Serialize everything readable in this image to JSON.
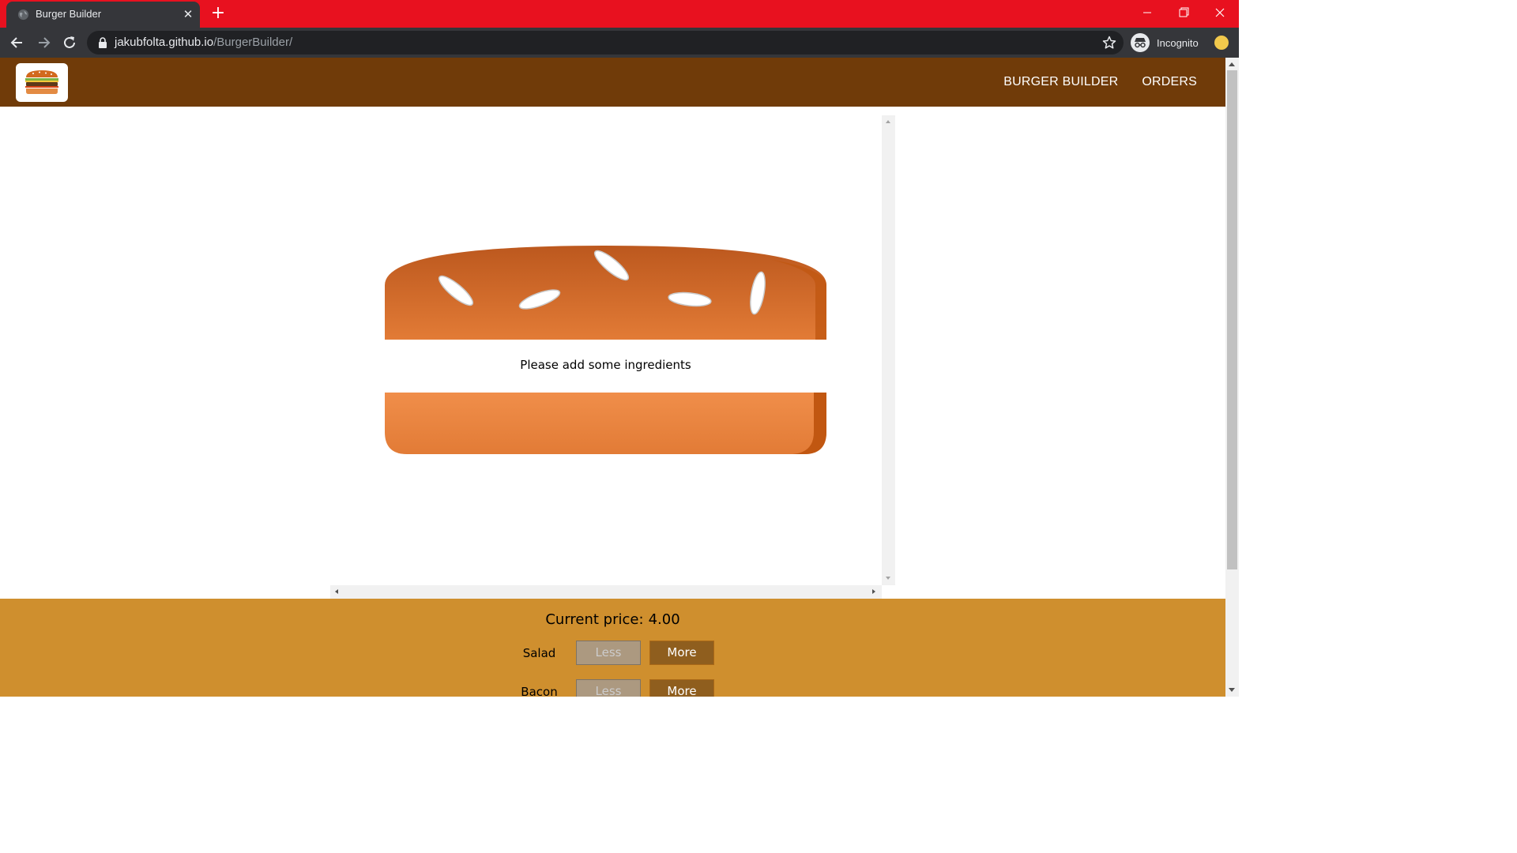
{
  "browser": {
    "tab_title": "Burger Builder",
    "url_host": "jakubfolta.github.io",
    "url_path": "/BurgerBuilder/",
    "profile_label": "Incognito"
  },
  "app": {
    "nav": [
      "BURGER BUILDER",
      "ORDERS"
    ],
    "empty_message": "Please add some ingredients",
    "price_label": "Current price:",
    "price_value": "4.00",
    "controls": [
      {
        "label": "Salad",
        "less": "Less",
        "more": "More"
      },
      {
        "label": "Bacon",
        "less": "Less",
        "more": "More"
      }
    ]
  },
  "colors": {
    "tabbar": "#e8111f",
    "appbar": "#703b09",
    "controls_bg": "#cf8f2e",
    "more_button": "#8f5e1e",
    "less_button_disabled": "#ac9980"
  }
}
